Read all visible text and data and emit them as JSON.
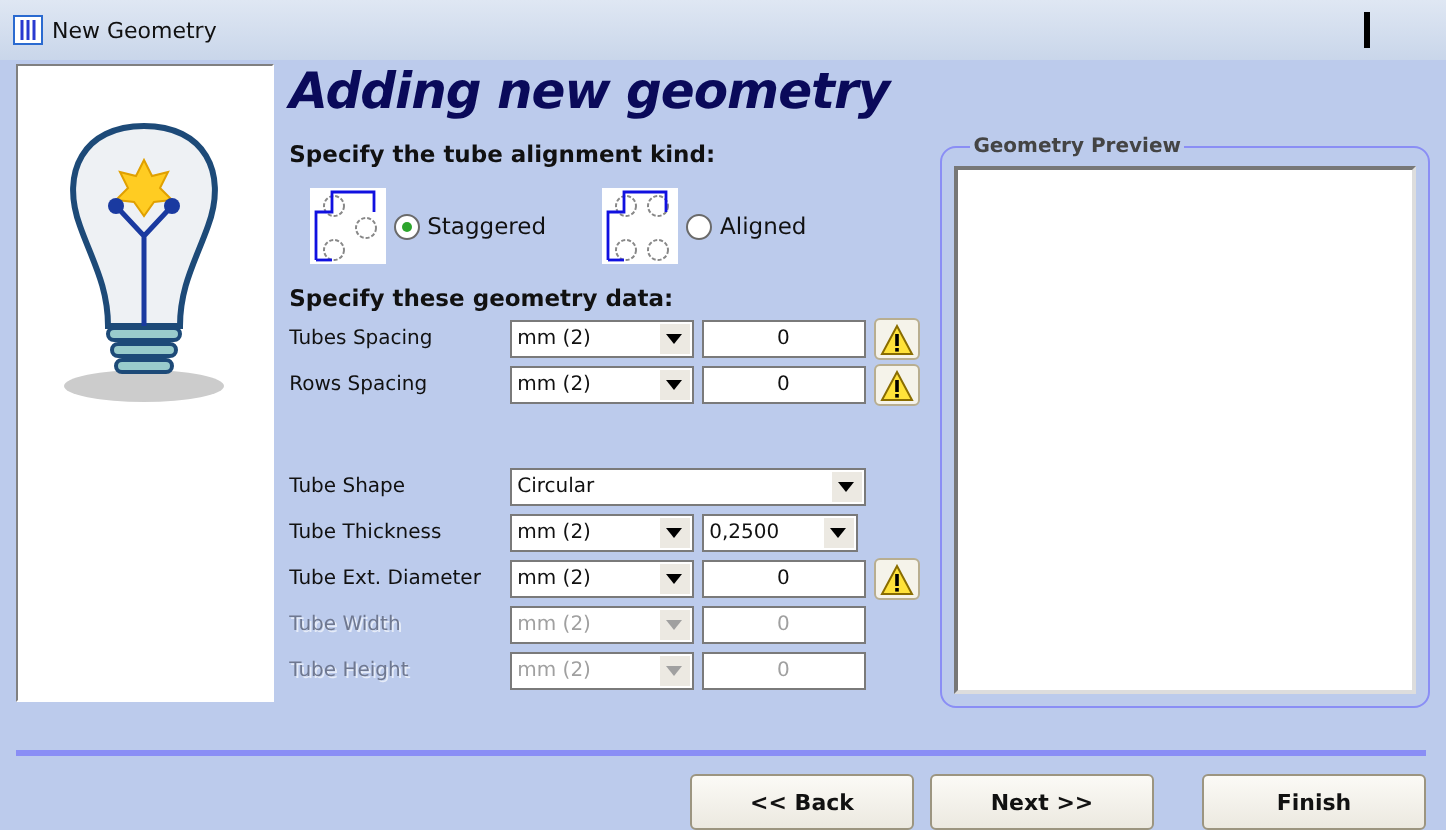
{
  "window": {
    "title": "New Geometry"
  },
  "heading": "Adding new geometry",
  "alignment": {
    "label": "Specify the tube alignment kind:",
    "options": [
      {
        "label": "Staggered",
        "kind": "staggered",
        "selected": true
      },
      {
        "label": "Aligned",
        "kind": "aligned",
        "selected": false
      }
    ]
  },
  "geometry": {
    "label": "Specify these geometry data:",
    "groups": [
      [
        {
          "label": "Tubes Spacing",
          "kind": "unit_value",
          "unit": "mm (2)",
          "value": "0",
          "warning": true,
          "disabled": false
        },
        {
          "label": "Rows Spacing",
          "kind": "unit_value",
          "unit": "mm (2)",
          "value": "0",
          "warning": true,
          "disabled": false
        }
      ],
      [
        {
          "label": "Tube Shape",
          "kind": "choice",
          "value": "Circular",
          "disabled": false
        },
        {
          "label": "Tube Thickness",
          "kind": "unit_choice",
          "unit": "mm (2)",
          "value": "0,2500",
          "disabled": false
        },
        {
          "label": "Tube Ext. Diameter",
          "kind": "unit_value",
          "unit": "mm (2)",
          "value": "0",
          "warning": true,
          "disabled": false
        },
        {
          "label": "Tube Width",
          "kind": "unit_value",
          "unit": "mm (2)",
          "value": "0",
          "warning": false,
          "disabled": true
        },
        {
          "label": "Tube Height",
          "kind": "unit_value",
          "unit": "mm (2)",
          "value": "0",
          "warning": false,
          "disabled": true
        }
      ]
    ]
  },
  "preview": {
    "title": "Geometry Preview"
  },
  "buttons": [
    "<< Back",
    "Next >>",
    "Finish"
  ]
}
